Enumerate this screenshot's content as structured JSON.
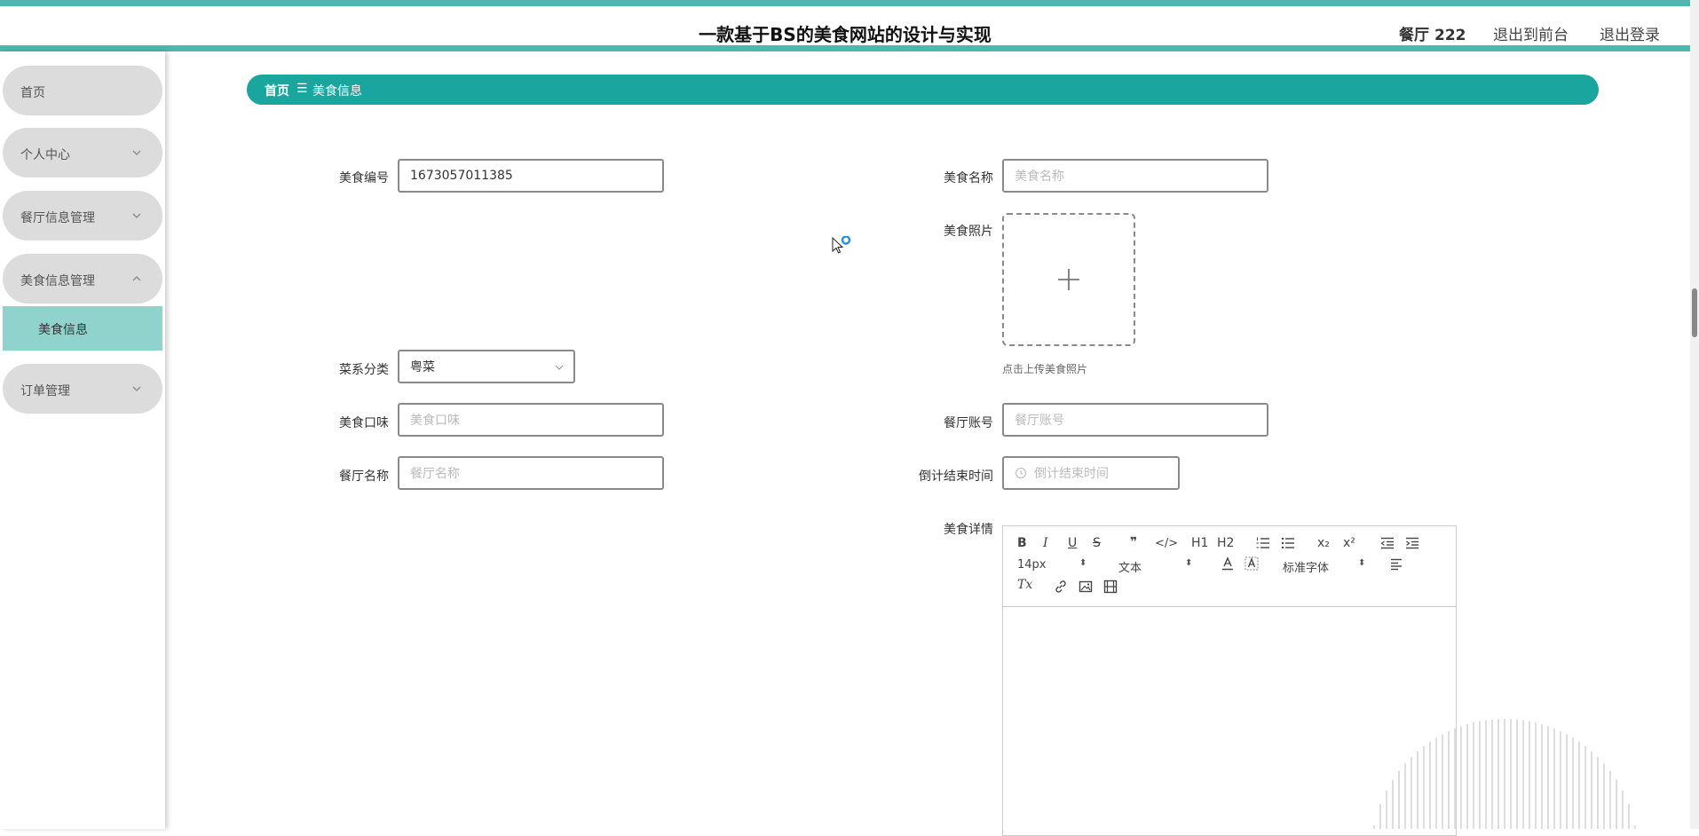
{
  "header": {
    "title": "一款基于BS的美食网站的设计与实现",
    "user_role": "餐厅",
    "user_name": "222",
    "back_to_front": "退出到前台",
    "logout": "退出登录"
  },
  "sidebar": {
    "items": [
      {
        "label": "首页"
      },
      {
        "label": "个人中心",
        "expanded": false
      },
      {
        "label": "餐厅信息管理",
        "expanded": false
      },
      {
        "label": "美食信息管理",
        "expanded": true
      },
      {
        "label": "订单管理",
        "expanded": false
      }
    ],
    "submenu": [
      {
        "label": "美食信息",
        "active": true
      }
    ]
  },
  "breadcrumb": {
    "home": "首页",
    "separator": "☰",
    "current": "美食信息"
  },
  "form": {
    "food_code": {
      "label": "美食编号",
      "value": "1673057011385"
    },
    "food_name": {
      "label": "美食名称",
      "placeholder": "美食名称"
    },
    "food_photo": {
      "label": "美食照片",
      "tip": "点击上传美食照片"
    },
    "cuisine": {
      "label": "菜系分类",
      "value": "粤菜"
    },
    "taste": {
      "label": "美食口味",
      "placeholder": "美食口味"
    },
    "restaurant_account": {
      "label": "餐厅账号",
      "placeholder": "餐厅账号"
    },
    "restaurant_name": {
      "label": "餐厅名称",
      "placeholder": "餐厅名称"
    },
    "countdown_end": {
      "label": "倒计结束时间",
      "placeholder": "倒计结束时间"
    },
    "details": {
      "label": "美食详情"
    }
  },
  "editor": {
    "font_size": "14px",
    "text_style": "文本",
    "font_family": "标准字体",
    "buttons": {
      "bold": "B",
      "italic": "I",
      "underline": "U",
      "strike": "S",
      "quote": "❞",
      "code": "</>",
      "h1": "H1",
      "h2": "H2",
      "sub": "x₂",
      "sup": "x²",
      "clear": "Tx"
    }
  },
  "colors": {
    "accent": "#1aa69e",
    "accent_light": "#4db8ae",
    "active_menu": "#90d2cc",
    "menu_bg": "#dcdcdc"
  }
}
